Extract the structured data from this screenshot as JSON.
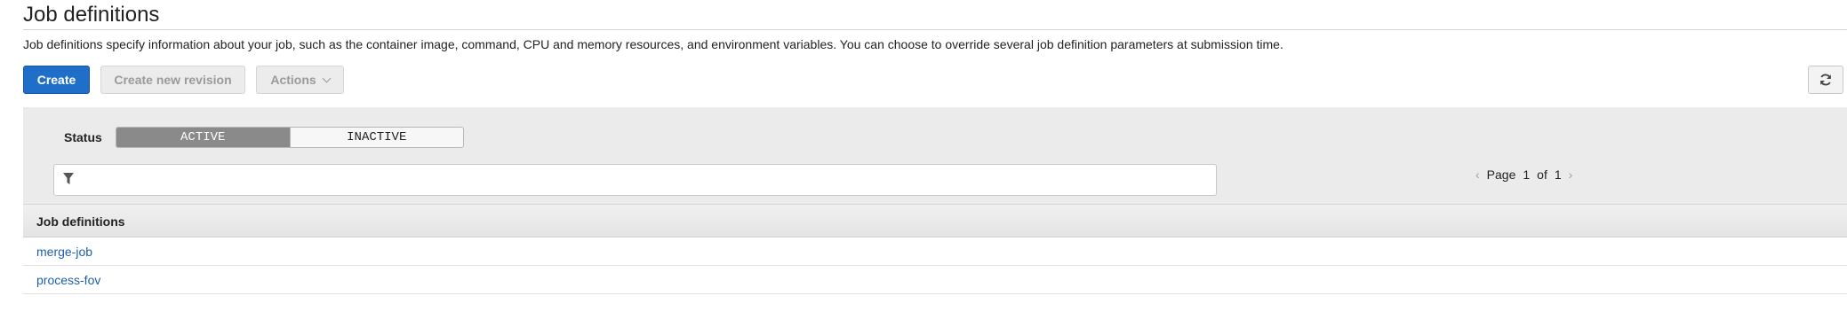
{
  "header": {
    "title": "Job definitions",
    "description": "Job definitions specify information about your job, such as the container image, command, CPU and memory resources, and environment variables. You can choose to override several job definition parameters at submission time."
  },
  "toolbar": {
    "create_label": "Create",
    "create_revision_label": "Create new revision",
    "actions_label": "Actions",
    "refresh_icon": "refresh-icon"
  },
  "filters": {
    "status_label": "Status",
    "status_options": [
      {
        "label": "ACTIVE",
        "selected": true
      },
      {
        "label": "INACTIVE",
        "selected": false
      }
    ],
    "search_placeholder": "",
    "filter_icon": "filter-icon"
  },
  "pagination": {
    "prefix": "Page",
    "current": "1",
    "separator": "of",
    "total": "1"
  },
  "table": {
    "column_header": "Job definitions",
    "rows": [
      {
        "name": "merge-job"
      },
      {
        "name": "process-fov"
      }
    ]
  },
  "colors": {
    "primary": "#1f6fc9",
    "link": "#1f5fa8",
    "segment_active": "#8a8a8a",
    "panel_bg": "#ebebeb"
  }
}
